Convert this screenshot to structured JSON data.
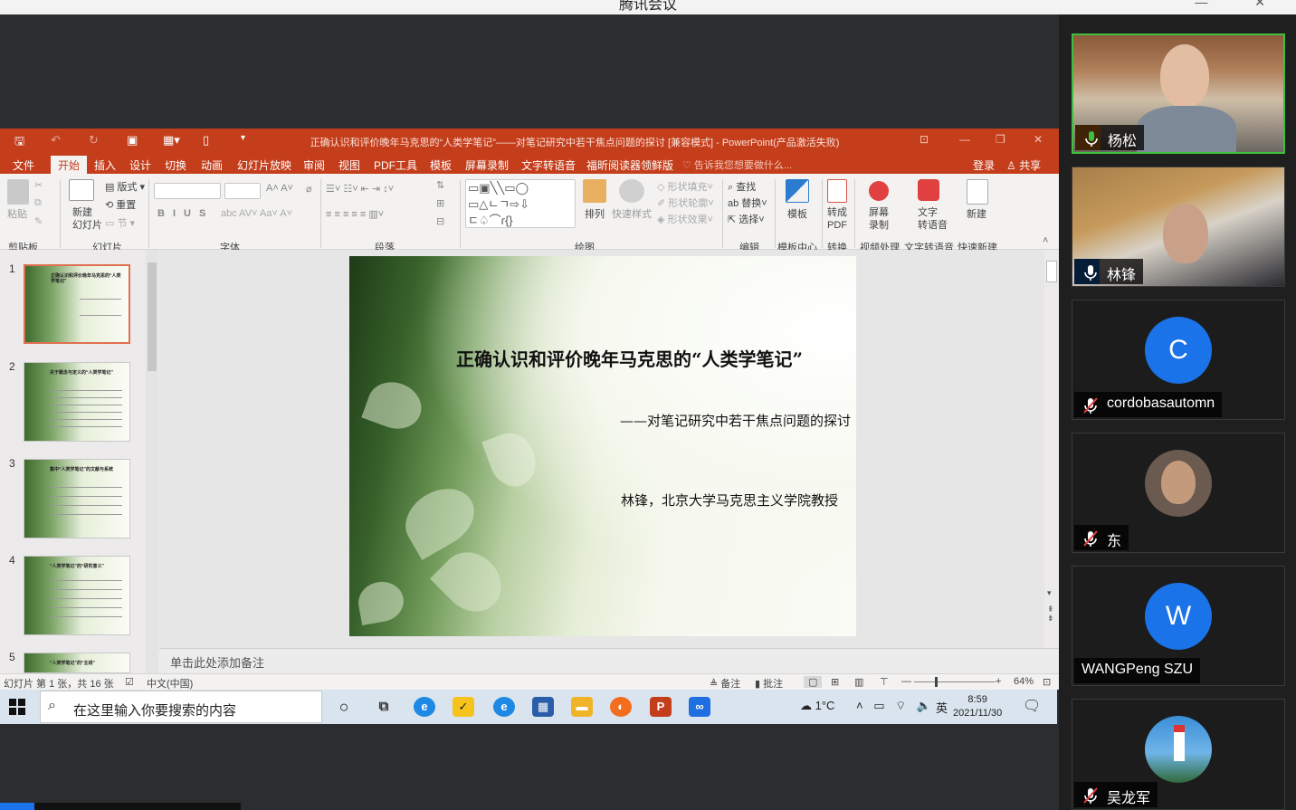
{
  "meeting": {
    "title": "腾讯会议"
  },
  "ppt": {
    "window_title": "正确认识和评价晚年马克思的“人类学笔记”——对笔记研究中若干焦点问题的探讨 [兼容模式] - PowerPoint(产品激活失败)",
    "menu": [
      "文件",
      "开始",
      "插入",
      "设计",
      "切换",
      "动画",
      "幻灯片放映",
      "审阅",
      "视图",
      "PDF工具",
      "模板",
      "屏幕录制",
      "文字转语音",
      "福昕阅读器领鲜版"
    ],
    "tell_me": "♡ 告诉我您想要做什么...",
    "login": "登录",
    "share": "共享",
    "ribbon": {
      "paste": "粘贴",
      "new_slide": "新建\n幻灯片",
      "layout": "版式",
      "reset": "重置",
      "section": "节",
      "arrange": "排列",
      "quick_styles": "快速样式",
      "shape_fill": "形状填充",
      "shape_outline": "形状轮廓",
      "shape_effects": "形状效果",
      "find": "查找",
      "replace": "替换",
      "select": "选择",
      "template": "模板",
      "to_pdf": "转成\nPDF",
      "screen_rec": "屏幕\n录制",
      "tts": "文字\n转语音",
      "new": "新建",
      "groups": [
        "剪贴板",
        "幻灯片",
        "字体",
        "段落",
        "绘图",
        "编辑",
        "模板中心",
        "转换",
        "视频处理",
        "文字转语音",
        "快速新建"
      ]
    },
    "slide": {
      "title": "正确认识和评价晚年马克思的“人类学笔记”",
      "subtitle": "——对笔记研究中若干焦点问题的探讨",
      "author": "林锋，北京大学马克思主义学院教授"
    },
    "thumb_numbers": [
      "1",
      "2",
      "3",
      "4",
      "5"
    ],
    "thumb_titles": [
      "正确认识和评价晚年马克思的“人类学笔记”",
      "关于概念与定义的“人类学笔记”",
      "集中“人类学笔记”的文献与系统",
      "“人类学笔记”的“研究意义”",
      "“人类学笔记”的“主线”"
    ],
    "notes_placeholder": "单击此处添加备注",
    "status": {
      "slide_count": "幻灯片 第 1 张，共 16 张",
      "language": "中文(中国)",
      "notes": "备注",
      "comments": "批注",
      "zoom": "64%"
    }
  },
  "taskbar": {
    "search_placeholder": "在这里输入你要搜索的内容",
    "temperature": "1°C",
    "ime": "英",
    "time": "8:59",
    "date": "2021/11/30"
  },
  "participants": [
    {
      "name": "杨松",
      "muted": false,
      "type": "video"
    },
    {
      "name": "林锋",
      "muted": false,
      "type": "video"
    },
    {
      "name": "cordobasautomn",
      "muted": true,
      "type": "avatar",
      "initial": "C",
      "color": "#1a73e8"
    },
    {
      "name": "东",
      "muted": true,
      "type": "photo"
    },
    {
      "name": "WANGPeng SZU",
      "muted": false,
      "type": "avatar",
      "initial": "W",
      "color": "#1a73e8"
    },
    {
      "name": "吴龙军",
      "muted": true,
      "type": "photo"
    }
  ]
}
